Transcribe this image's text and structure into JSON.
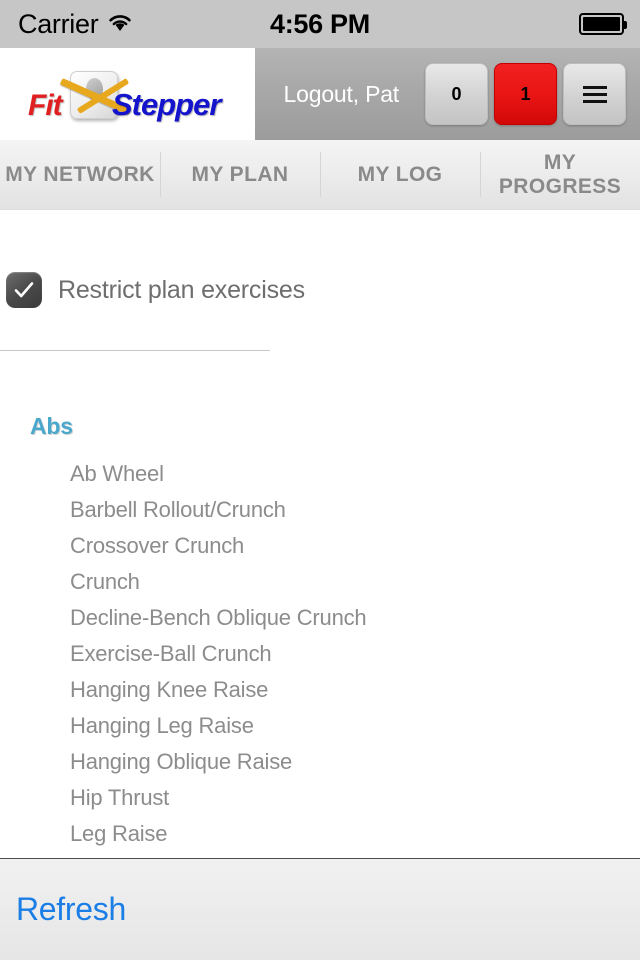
{
  "status_bar": {
    "carrier": "Carrier",
    "wifi_icon": "wifi-icon",
    "time": "4:56 PM",
    "battery_icon": "battery-full-icon"
  },
  "header": {
    "logo": {
      "first_word": "Fit",
      "second_word": "Stepper",
      "graphic": "bathroom-scale-tape-measure-icon"
    },
    "logout_label": "Logout, Pat",
    "buttons": [
      {
        "name": "notifications-count-button",
        "label": "0",
        "style": "grey"
      },
      {
        "name": "alerts-count-button",
        "label": "1",
        "style": "red"
      },
      {
        "name": "menu-button",
        "label": "",
        "style": "grey",
        "icon": "hamburger-menu-icon"
      }
    ]
  },
  "tabs": [
    {
      "label": "MY NETWORK",
      "name": "tab-my-network"
    },
    {
      "label": "MY PLAN",
      "name": "tab-my-plan"
    },
    {
      "label": "MY LOG",
      "name": "tab-my-log"
    },
    {
      "label": "MY PROGRESS",
      "name": "tab-my-progress"
    }
  ],
  "main": {
    "restrict_checkbox": {
      "label": "Restrict plan exercises",
      "checked": true,
      "check_glyph": "✓"
    },
    "group_title": "Abs",
    "exercises": [
      "Ab Wheel",
      "Barbell Rollout/Crunch",
      "Crossover Crunch",
      "Crunch",
      "Decline-Bench Oblique Crunch",
      "Exercise-Ball Crunch",
      "Hanging Knee Raise",
      "Hanging Leg Raise",
      "Hanging Oblique Raise",
      "Hip Thrust",
      "Leg Raise"
    ]
  },
  "toolbar": {
    "refresh_label": "Refresh"
  },
  "colors": {
    "accent_blue": "#1a7ee6",
    "group_title_blue": "#4aa8cc",
    "alert_red": "#e81414",
    "logo_red": "#e02020",
    "logo_blue": "#1414cc"
  }
}
